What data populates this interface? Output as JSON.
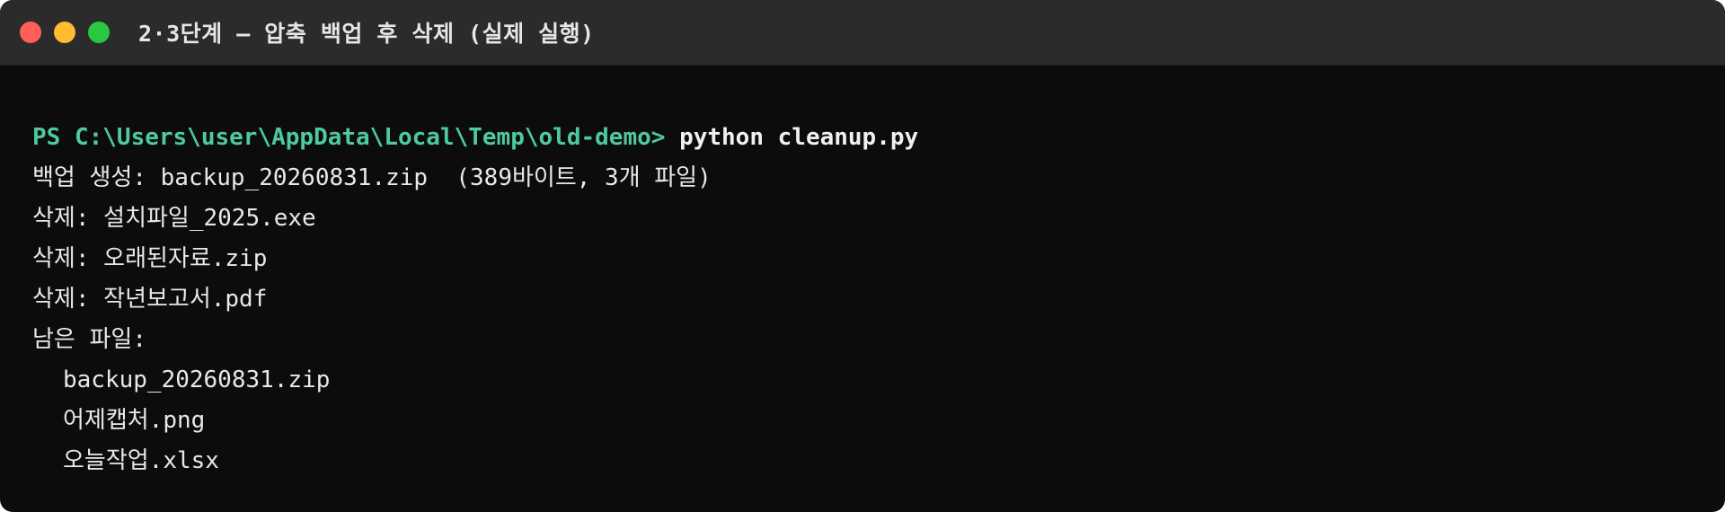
{
  "window": {
    "title": "2·3단계 — 압축 백업 후 삭제 (실제 실행)",
    "colors": {
      "background": "#0c0c0c",
      "titlebar": "#2b2b2b",
      "prompt": "#4ec9a0",
      "text": "#e8e8e8",
      "close": "#ff5f57",
      "minimize": "#febc2e",
      "maximize": "#28c840"
    }
  },
  "terminal": {
    "prompt": "PS C:\\Users\\user\\AppData\\Local\\Temp\\old-demo>",
    "command": "python cleanup.py",
    "output": [
      "백업 생성: backup_20260831.zip  (389바이트, 3개 파일)",
      "삭제: 설치파일_2025.exe",
      "삭제: 오래된자료.zip",
      "삭제: 작년보고서.pdf",
      "남은 파일:"
    ],
    "remaining_files": [
      "backup_20260831.zip",
      "어제캡처.png",
      "오늘작업.xlsx"
    ]
  }
}
